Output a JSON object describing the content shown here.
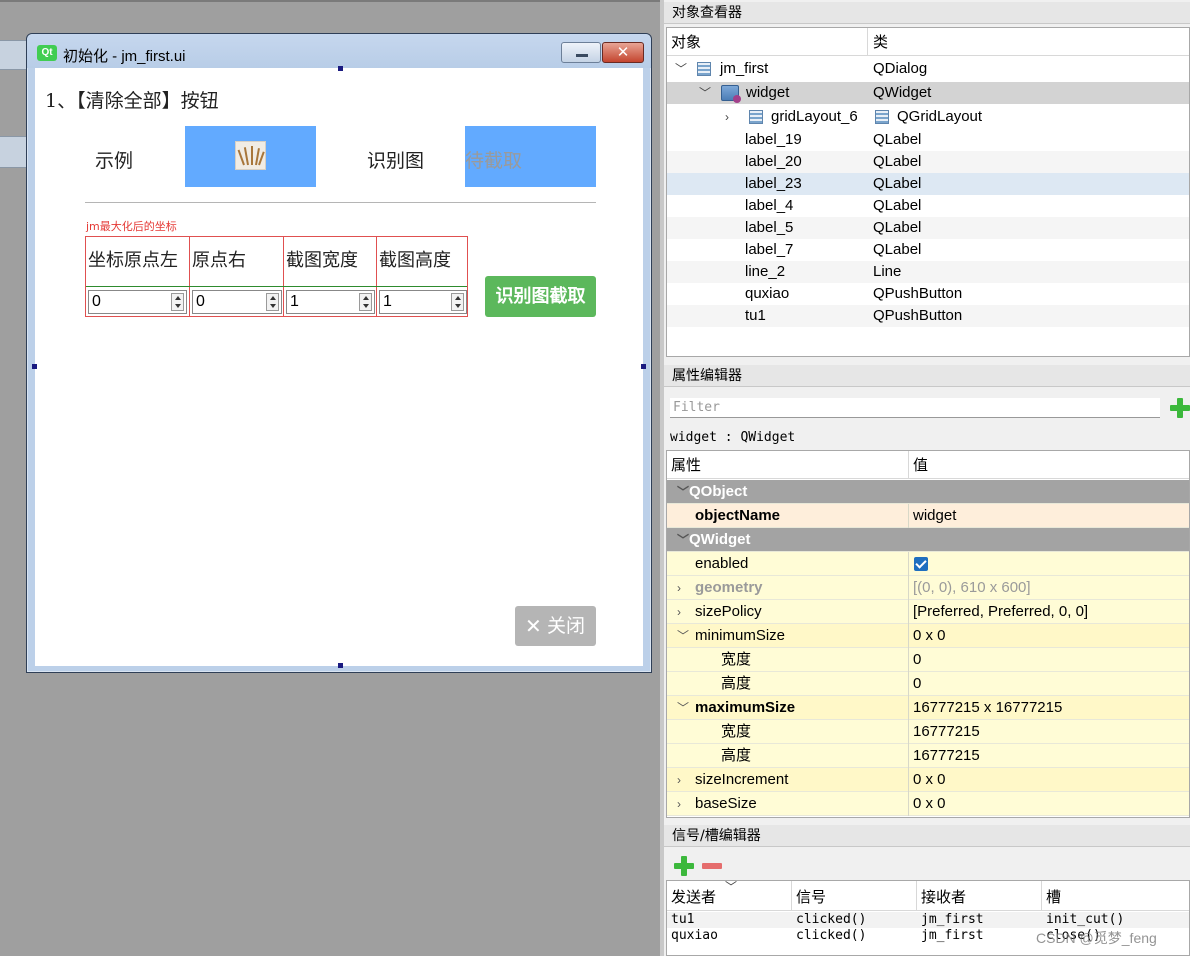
{
  "dialog": {
    "title": "初始化 - jm_first.ui",
    "logo": "Qt",
    "close_glyph": "✕",
    "heading": "1、【清除全部】按钮",
    "sample_label": "示例",
    "recog_label": "识别图",
    "pending_text": "待截取",
    "coord_caption": "jm最大化后的坐标",
    "grid_headers": [
      "坐标原点左",
      "原点右",
      "截图宽度",
      "截图高度"
    ],
    "spin_values": [
      "0",
      "0",
      "1",
      "1"
    ],
    "cut_button": "识别图截取",
    "close_button_icon": "✕",
    "close_button": "关闭"
  },
  "object_inspector": {
    "title": "对象查看器",
    "col_object": "对象",
    "col_class": "类",
    "rows": [
      {
        "name": "jm_first",
        "cls": "QDialog"
      },
      {
        "name": "widget",
        "cls": "QWidget"
      },
      {
        "name": "gridLayout_6",
        "cls": "QGridLayout"
      },
      {
        "name": "label_19",
        "cls": "QLabel"
      },
      {
        "name": "label_20",
        "cls": "QLabel"
      },
      {
        "name": "label_23",
        "cls": "QLabel"
      },
      {
        "name": "label_4",
        "cls": "QLabel"
      },
      {
        "name": "label_5",
        "cls": "QLabel"
      },
      {
        "name": "label_7",
        "cls": "QLabel"
      },
      {
        "name": "line_2",
        "cls": "Line"
      },
      {
        "name": "quxiao",
        "cls": "QPushButton"
      },
      {
        "name": "tu1",
        "cls": "QPushButton"
      }
    ]
  },
  "property_editor": {
    "title": "属性编辑器",
    "filter_placeholder": "Filter",
    "object_label": "widget : QWidget",
    "col_property": "属性",
    "col_value": "值",
    "rows": [
      {
        "k": "QObject",
        "v": ""
      },
      {
        "k": "objectName",
        "v": "widget"
      },
      {
        "k": "QWidget",
        "v": ""
      },
      {
        "k": "enabled",
        "v": ""
      },
      {
        "k": "geometry",
        "v": "[(0, 0), 610 x 600]"
      },
      {
        "k": "sizePolicy",
        "v": "[Preferred, Preferred, 0, 0]"
      },
      {
        "k": "minimumSize",
        "v": "0 x 0"
      },
      {
        "k": "宽度",
        "v": "0"
      },
      {
        "k": "高度",
        "v": "0"
      },
      {
        "k": "maximumSize",
        "v": "16777215 x 16777215"
      },
      {
        "k": "宽度",
        "v": "16777215"
      },
      {
        "k": "高度",
        "v": "16777215"
      },
      {
        "k": "sizeIncrement",
        "v": "0 x 0"
      },
      {
        "k": "baseSize",
        "v": "0 x 0"
      }
    ]
  },
  "signal_editor": {
    "title": "信号/槽编辑器",
    "cols": [
      "发送者",
      "信号",
      "接收者",
      "槽"
    ],
    "rows": [
      [
        "tu1",
        "clicked()",
        "jm_first",
        "init_cut()"
      ],
      [
        "quxiao",
        "clicked()",
        "jm_first",
        "close()"
      ]
    ]
  },
  "watermark": "CSDN @觅梦_feng",
  "colors": {
    "blue_box": "#62aaff",
    "green_button": "#5cb85c",
    "section_gray": "#a3a3a3"
  }
}
